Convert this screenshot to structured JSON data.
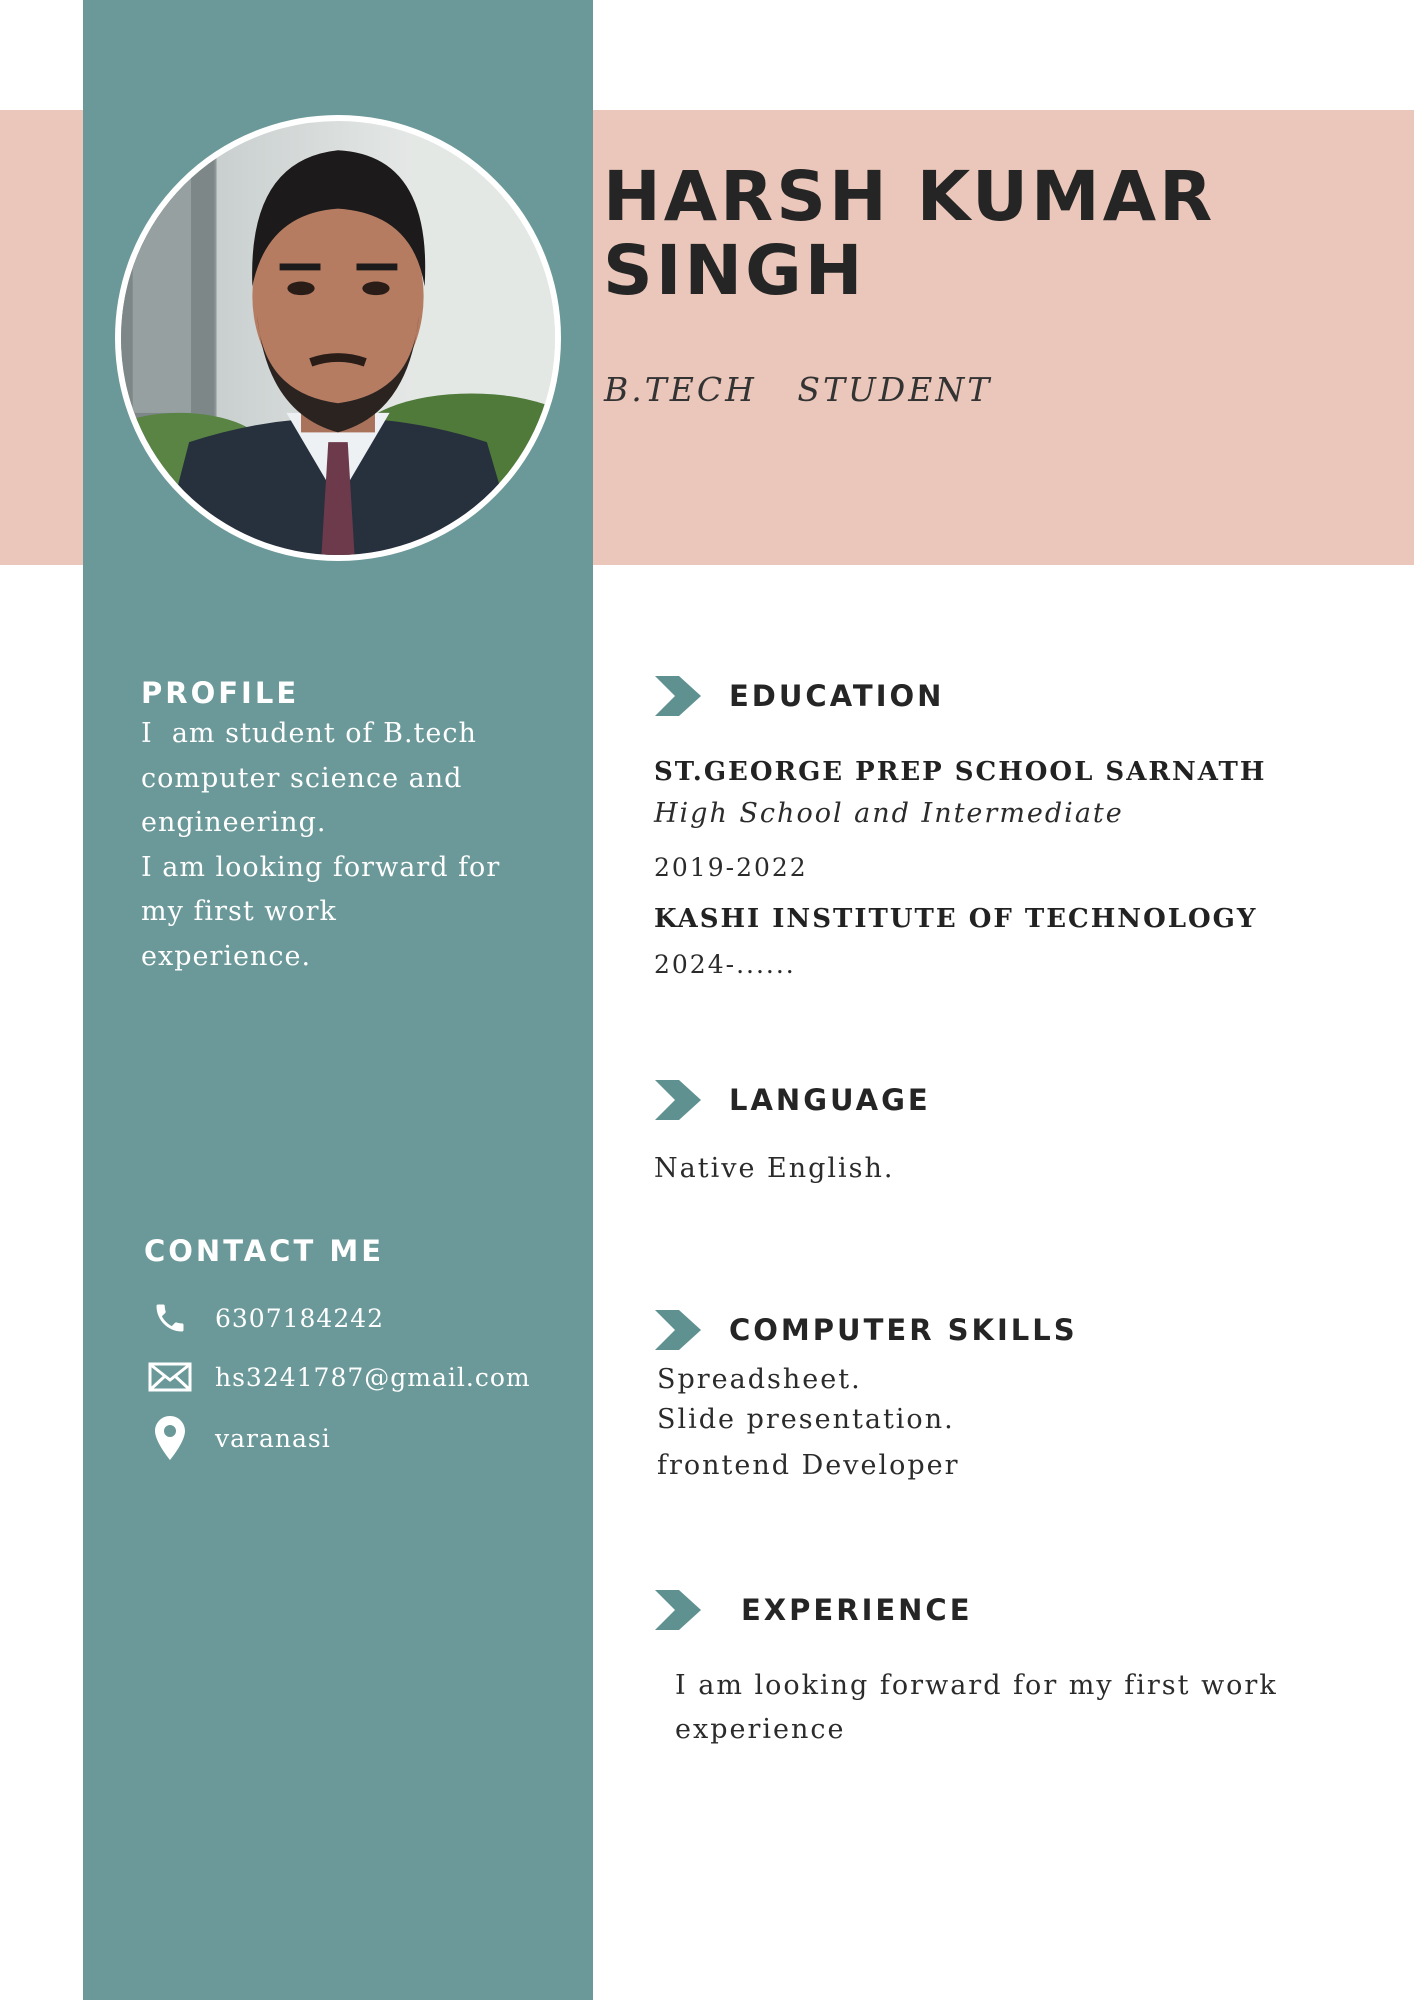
{
  "header": {
    "name_line1": "HARSH KUMAR",
    "name_line2": "SINGH",
    "role": "B.TECH   STUDENT"
  },
  "profile": {
    "heading": "PROFILE",
    "lines": [
      "I  am student of B.tech",
      "computer science and",
      "engineering.",
      "I am looking forward for",
      "my first work",
      "experience."
    ]
  },
  "contact": {
    "heading": "CONTACT ME",
    "phone": "6307184242",
    "email": "hs3241787@gmail.com",
    "location": "varanasi",
    "icons": [
      "phone-icon",
      "mail-icon",
      "location-pin-icon"
    ]
  },
  "education": {
    "heading": "EDUCATION",
    "school1": "ST.GEORGE PREP SCHOOL SARNATH",
    "school1_desc": "High School and Intermediate",
    "school1_years": "2019-2022",
    "school2": "KASHI INSTITUTE OF TECHNOLOGY",
    "school2_years": "2024-......"
  },
  "language": {
    "heading": "LANGUAGE",
    "text": "Native English."
  },
  "skills": {
    "heading": "COMPUTER SKILLS",
    "items": [
      "Spreadsheet.",
      "Slide presentation.",
      "frontend Developer"
    ]
  },
  "experience": {
    "heading": "EXPERIENCE",
    "line1": "I am looking forward for my first work",
    "line2": "experience"
  },
  "colors": {
    "sidebar": "#6b9898",
    "header_band": "#eac7ba",
    "chevron": "#5f9191"
  }
}
